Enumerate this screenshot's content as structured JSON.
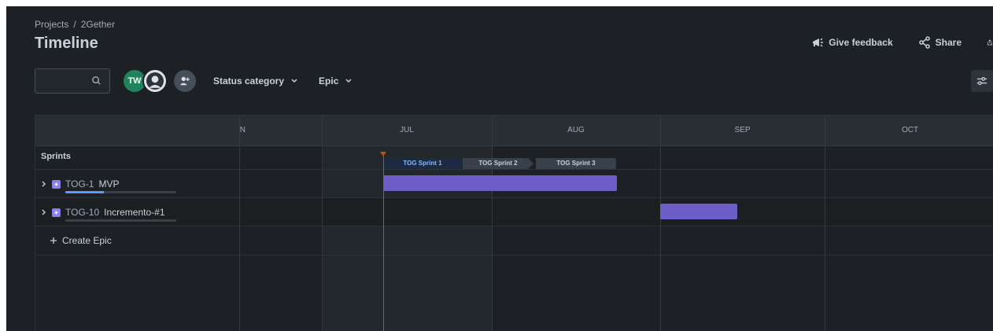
{
  "breadcrumb": {
    "projects": "Projects",
    "separator": "/",
    "project": "2Gether"
  },
  "page": {
    "title": "Timeline"
  },
  "actions": {
    "feedback": "Give feedback",
    "share": "Share"
  },
  "search": {
    "value": "",
    "placeholder": ""
  },
  "avatars": {
    "user_initials": "TW"
  },
  "filters": {
    "status": "Status category",
    "epic": "Epic"
  },
  "timeline": {
    "months": [
      "JUN",
      "JUL",
      "AUG",
      "SEP",
      "OCT"
    ],
    "sprints_label": "Sprints",
    "sprints": [
      {
        "name": "TOG Sprint 1",
        "state": "active"
      },
      {
        "name": "TOG Sprint 2",
        "state": "future"
      },
      {
        "name": "TOG Sprint 3",
        "state": "future"
      }
    ],
    "epics": [
      {
        "key": "TOG-1",
        "name": "MVP",
        "progress": 0.35
      },
      {
        "key": "TOG-10",
        "name": "Incremento-#1",
        "progress": 0.0
      }
    ],
    "create_epic": "Create Epic"
  },
  "colors": {
    "background": "#1d2125",
    "epic_bar": "#6e5dc6",
    "today_marker": "#c25100",
    "avatar_tw": "#1f845a",
    "progress": "#579dff"
  }
}
